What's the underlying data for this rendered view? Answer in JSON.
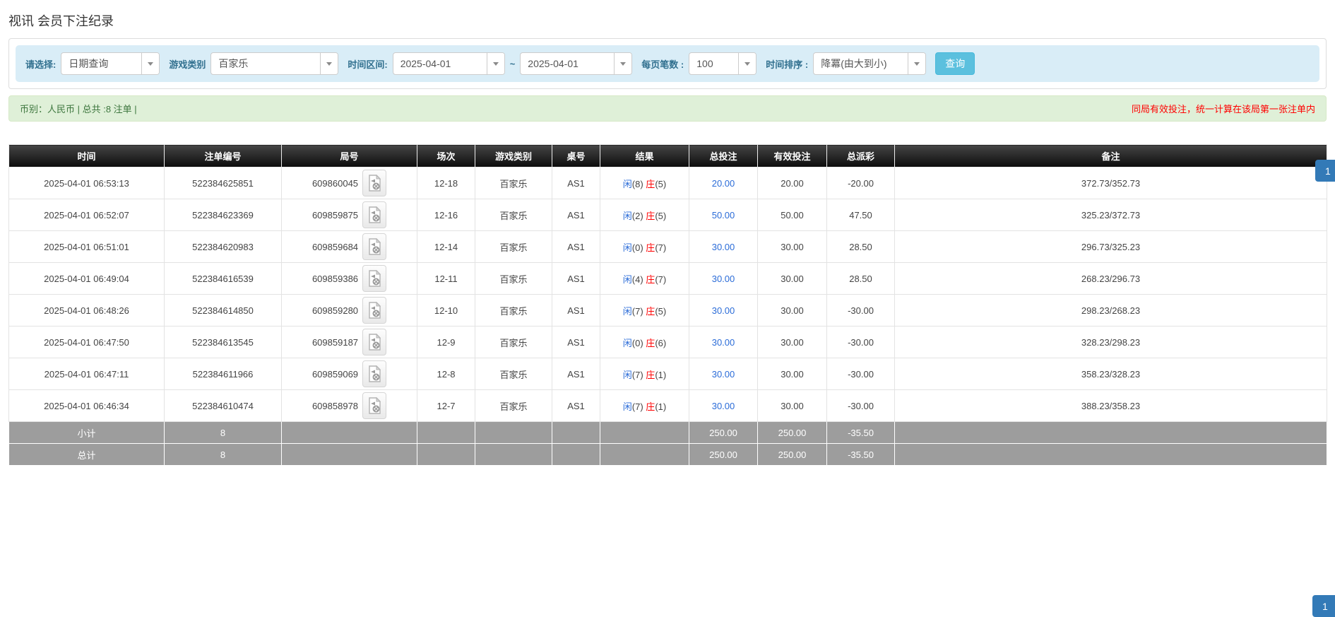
{
  "page": {
    "title": "视讯 会员下注纪录"
  },
  "filters": {
    "select_label": "请选择:",
    "select_value": "日期查询",
    "game_type_label": "游戏类别",
    "game_type_value": "百家乐",
    "time_range_label": "时间区间:",
    "date_from": "2025-04-01",
    "range_separator": "~",
    "date_to": "2025-04-01",
    "per_page_label": "每页笔数 :",
    "per_page_value": "100",
    "sort_label": "时间排序 :",
    "sort_value": "降冪(由大到小)",
    "search_button": "查询"
  },
  "summary_bar": {
    "left_text": "币别：人民币 | 总共 :8 注单 |",
    "right_text": "同局有效投注，统一计算在该局第一张注单内"
  },
  "pagination": {
    "page": "1"
  },
  "icons": {
    "video_icon": "video-icon",
    "caret_icon": "chevron-down-icon"
  },
  "colors": {
    "accent_blue": "#2b6cd8",
    "negative_red": "#ff0000",
    "filter_bg": "#d9edf7",
    "success_bg": "#dff0d8",
    "success_text": "#3c763d",
    "header_bg": "#1a1a1a",
    "summary_row_bg": "#9d9d9d",
    "search_btn": "#5bc0de",
    "pager_active": "#337ab7"
  },
  "table": {
    "headers": [
      "时间",
      "注单编号",
      "局号",
      "场次",
      "游戏类别",
      "桌号",
      "结果",
      "总投注",
      "有效投注",
      "总派彩",
      "备注"
    ],
    "rows": [
      {
        "time": "2025-04-01 06:53:13",
        "bet_id": "522384625851",
        "round_id": "609860045",
        "session": "12-18",
        "game": "百家乐",
        "table_no": "AS1",
        "result": {
          "player_label": "闲",
          "player_num": "(8)",
          "banker_label": "庄",
          "banker_num": "(5)"
        },
        "total_bet": "20.00",
        "valid_bet": "20.00",
        "payout": "-20.00",
        "payout_negative": true,
        "remark": "372.73/352.73"
      },
      {
        "time": "2025-04-01 06:52:07",
        "bet_id": "522384623369",
        "round_id": "609859875",
        "session": "12-16",
        "game": "百家乐",
        "table_no": "AS1",
        "result": {
          "player_label": "闲",
          "player_num": "(2)",
          "banker_label": "庄",
          "banker_num": "(5)"
        },
        "total_bet": "50.00",
        "valid_bet": "50.00",
        "payout": "47.50",
        "payout_negative": false,
        "remark": "325.23/372.73"
      },
      {
        "time": "2025-04-01 06:51:01",
        "bet_id": "522384620983",
        "round_id": "609859684",
        "session": "12-14",
        "game": "百家乐",
        "table_no": "AS1",
        "result": {
          "player_label": "闲",
          "player_num": "(0)",
          "banker_label": "庄",
          "banker_num": "(7)"
        },
        "total_bet": "30.00",
        "valid_bet": "30.00",
        "payout": "28.50",
        "payout_negative": false,
        "remark": "296.73/325.23"
      },
      {
        "time": "2025-04-01 06:49:04",
        "bet_id": "522384616539",
        "round_id": "609859386",
        "session": "12-11",
        "game": "百家乐",
        "table_no": "AS1",
        "result": {
          "player_label": "闲",
          "player_num": "(4)",
          "banker_label": "庄",
          "banker_num": "(7)"
        },
        "total_bet": "30.00",
        "valid_bet": "30.00",
        "payout": "28.50",
        "payout_negative": false,
        "remark": "268.23/296.73"
      },
      {
        "time": "2025-04-01 06:48:26",
        "bet_id": "522384614850",
        "round_id": "609859280",
        "session": "12-10",
        "game": "百家乐",
        "table_no": "AS1",
        "result": {
          "player_label": "闲",
          "player_num": "(7)",
          "banker_label": "庄",
          "banker_num": "(5)"
        },
        "total_bet": "30.00",
        "valid_bet": "30.00",
        "payout": "-30.00",
        "payout_negative": true,
        "remark": "298.23/268.23"
      },
      {
        "time": "2025-04-01 06:47:50",
        "bet_id": "522384613545",
        "round_id": "609859187",
        "session": "12-9",
        "game": "百家乐",
        "table_no": "AS1",
        "result": {
          "player_label": "闲",
          "player_num": "(0)",
          "banker_label": "庄",
          "banker_num": "(6)"
        },
        "total_bet": "30.00",
        "valid_bet": "30.00",
        "payout": "-30.00",
        "payout_negative": true,
        "remark": "328.23/298.23"
      },
      {
        "time": "2025-04-01 06:47:11",
        "bet_id": "522384611966",
        "round_id": "609859069",
        "session": "12-8",
        "game": "百家乐",
        "table_no": "AS1",
        "result": {
          "player_label": "闲",
          "player_num": "(7)",
          "banker_label": "庄",
          "banker_num": "(1)"
        },
        "total_bet": "30.00",
        "valid_bet": "30.00",
        "payout": "-30.00",
        "payout_negative": true,
        "remark": "358.23/328.23"
      },
      {
        "time": "2025-04-01 06:46:34",
        "bet_id": "522384610474",
        "round_id": "609858978",
        "session": "12-7",
        "game": "百家乐",
        "table_no": "AS1",
        "result": {
          "player_label": "闲",
          "player_num": "(7)",
          "banker_label": "庄",
          "banker_num": "(1)"
        },
        "total_bet": "30.00",
        "valid_bet": "30.00",
        "payout": "-30.00",
        "payout_negative": true,
        "remark": "388.23/358.23"
      }
    ],
    "subtotal": {
      "label": "小计",
      "count": "8",
      "total_bet": "250.00",
      "valid_bet": "250.00",
      "payout": "-35.50"
    },
    "total": {
      "label": "总计",
      "count": "8",
      "total_bet": "250.00",
      "valid_bet": "250.00",
      "payout": "-35.50"
    }
  }
}
